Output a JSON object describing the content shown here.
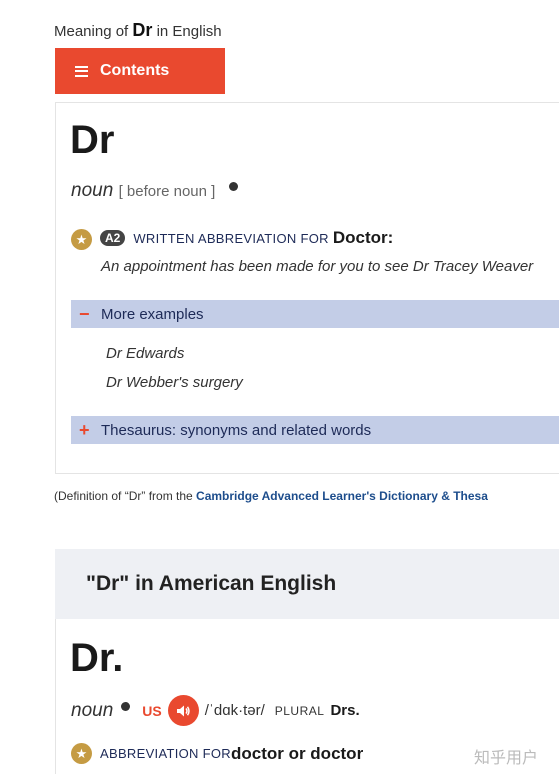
{
  "header": {
    "meaning_prefix": "Meaning of",
    "meaning_word": "Dr",
    "meaning_suffix": "in English",
    "contents_label": "Contents"
  },
  "entry1": {
    "headword": "Dr",
    "pos": "noun",
    "grammar": "[ before noun ]",
    "level": "A2",
    "abbrev_label": "WRITTEN ABBREVIATION FOR",
    "abbrev_word": "Doctor:",
    "example": "An appointment has been made for you to see Dr Tracey Weaver",
    "more_examples_label": "More examples",
    "more_examples_sign": "−",
    "more_examples": [
      "Dr Edwards",
      "Dr Webber's surgery"
    ],
    "thesaurus_label": "Thesaurus: synonyms and related words",
    "thesaurus_sign": "+"
  },
  "credit": {
    "prefix": "(Definition of “Dr” from the",
    "link": "Cambridge Advanced Learner's Dictionary & Thesa"
  },
  "entry2": {
    "section_title": "\"Dr\" in American English",
    "headword": "Dr.",
    "pos": "noun",
    "region": "US",
    "ipa": "/ˈdɑk·tər/",
    "plural_label": "PLURAL",
    "plural_word": "Drs.",
    "abbrev_label": "ABBREVIATION FOR",
    "abbrev_word": "doctor or doctor"
  },
  "watermark": "知乎用户",
  "colors": {
    "accent": "#e9492f",
    "bar": "#c3cde7",
    "star": "#c59b43",
    "link": "#1d4d8c"
  },
  "icons": {
    "menu": "hamburger-icon",
    "star": "star-icon",
    "speaker": "speaker-icon"
  }
}
